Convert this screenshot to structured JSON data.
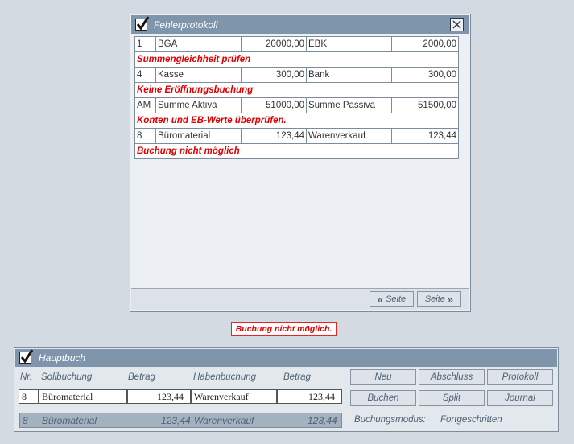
{
  "dialog": {
    "title": "Fehlerprotokoll",
    "rows": [
      {
        "type": "entry",
        "nr": "1",
        "soll": "BGA",
        "soll_betrag": "20000,00",
        "haben": "EBK",
        "haben_betrag": "2000,00"
      },
      {
        "type": "message",
        "text": "Summengleichheit prüfen"
      },
      {
        "type": "entry",
        "nr": "4",
        "soll": "Kasse",
        "soll_betrag": "300,00",
        "haben": "Bank",
        "haben_betrag": "300,00"
      },
      {
        "type": "message",
        "text": "Keine Eröffnungsbuchung"
      },
      {
        "type": "entry",
        "nr": "AM",
        "soll": "Summe Aktiva",
        "soll_betrag": "51000,00",
        "haben": "Summe Passiva",
        "haben_betrag": "51500,00"
      },
      {
        "type": "message",
        "text": "Konten und EB-Werte überprüfen."
      },
      {
        "type": "entry",
        "nr": "8",
        "soll": "Büromaterial",
        "soll_betrag": "123,44",
        "haben": "Warenverkauf",
        "haben_betrag": "123,44"
      },
      {
        "type": "message",
        "text": "Buchung nicht möglich"
      }
    ],
    "prev_page_label": "Seite",
    "next_page_label": "Seite"
  },
  "status_message": "Buchung nicht möglich.",
  "ledger": {
    "title": "Hauptbuch",
    "headers": {
      "nr": "Nr.",
      "soll": "Sollbuchung",
      "soll_betrag": "Betrag",
      "haben": "Habenbuchung",
      "haben_betrag": "Betrag"
    },
    "entry": {
      "nr": "8",
      "soll": "Büromaterial",
      "soll_betrag": "123,44",
      "haben": "Warenverkauf",
      "haben_betrag": "123,44"
    },
    "summary": {
      "nr": "8",
      "soll": "Büromaterial",
      "soll_betrag": "123,44",
      "haben": "Warenverkauf",
      "haben_betrag": "123,44"
    },
    "buttons": {
      "neu": "Neu",
      "abschluss": "Abschluss",
      "protokoll": "Protokoll",
      "buchen": "Buchen",
      "split": "Split",
      "journal": "Journal"
    },
    "mode_label": "Buchungsmodus:",
    "mode_value": "Fortgeschritten"
  },
  "colors": {
    "background": "#d3dae1",
    "titlebar": "#7e95ab",
    "error_text": "#e00000",
    "label_text": "#4d6275"
  },
  "icons": [
    "checkmark-icon",
    "close-icon",
    "double-chevron-left-icon",
    "double-chevron-right-icon"
  ]
}
